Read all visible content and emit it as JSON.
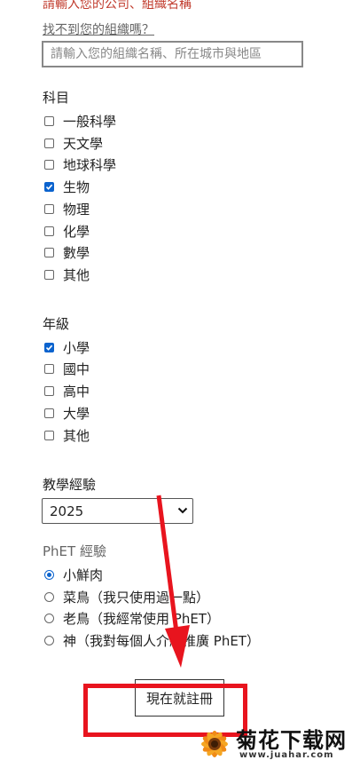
{
  "org": {
    "error": "請輸入您的公司、組織名稱",
    "link": "找不到您的組織嗎？",
    "placeholder": "請輸入您的組織名稱、所在城市與地區"
  },
  "subjects": {
    "label": "科目",
    "items": [
      {
        "label": "一般科學",
        "checked": false
      },
      {
        "label": "天文學",
        "checked": false
      },
      {
        "label": "地球科學",
        "checked": false
      },
      {
        "label": "生物",
        "checked": true
      },
      {
        "label": "物理",
        "checked": false
      },
      {
        "label": "化學",
        "checked": false
      },
      {
        "label": "數學",
        "checked": false
      },
      {
        "label": "其他",
        "checked": false
      }
    ]
  },
  "grades": {
    "label": "年級",
    "items": [
      {
        "label": "小學",
        "checked": true
      },
      {
        "label": "國中",
        "checked": false
      },
      {
        "label": "高中",
        "checked": false
      },
      {
        "label": "大學",
        "checked": false
      },
      {
        "label": "其他",
        "checked": false
      }
    ]
  },
  "experience": {
    "label": "教學經驗",
    "selected": "2025"
  },
  "phet": {
    "label": "PhET 經驗",
    "options": [
      {
        "label": "小鮮肉",
        "selected": true
      },
      {
        "label": "菜鳥（我只使用過一點）",
        "selected": false
      },
      {
        "label": "老鳥（我經常使用 PhET）",
        "selected": false
      },
      {
        "label": "神（我對每個人介紹推廣 PhET）",
        "selected": false
      }
    ]
  },
  "register_button": "現在就註冊",
  "watermark": {
    "title": "菊花下载网",
    "url": "www.juahar.com"
  },
  "colors": {
    "accent": "#0b63ce",
    "annotation_red": "#e8141e",
    "error": "#c0392b"
  }
}
